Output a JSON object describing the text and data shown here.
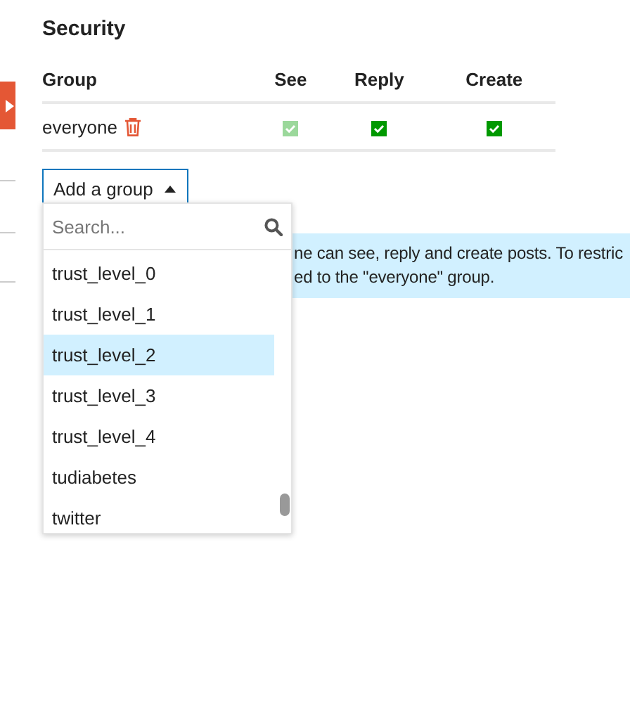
{
  "title": "Security",
  "table": {
    "columns": [
      "Group",
      "See",
      "Reply",
      "Create"
    ],
    "rows": [
      {
        "group": "everyone",
        "permissions": [
          {
            "checked": true,
            "disabled": true
          },
          {
            "checked": true,
            "disabled": false
          },
          {
            "checked": true,
            "disabled": false
          }
        ]
      }
    ]
  },
  "add_group": {
    "label": "Add a group",
    "expanded": true
  },
  "dropdown": {
    "search": {
      "placeholder": "Search..."
    },
    "items": [
      {
        "label": "trust_level_0",
        "selected": false
      },
      {
        "label": "trust_level_1",
        "selected": false
      },
      {
        "label": "trust_level_2",
        "selected": true
      },
      {
        "label": "trust_level_3",
        "selected": false
      },
      {
        "label": "trust_level_4",
        "selected": false
      },
      {
        "label": "tudiabetes",
        "selected": false
      },
      {
        "label": "twitter",
        "selected": false
      }
    ]
  },
  "notice": {
    "lines": [
      "ne can see, reply and create posts. To restric",
      "ed to the \"everyone\" group."
    ]
  }
}
